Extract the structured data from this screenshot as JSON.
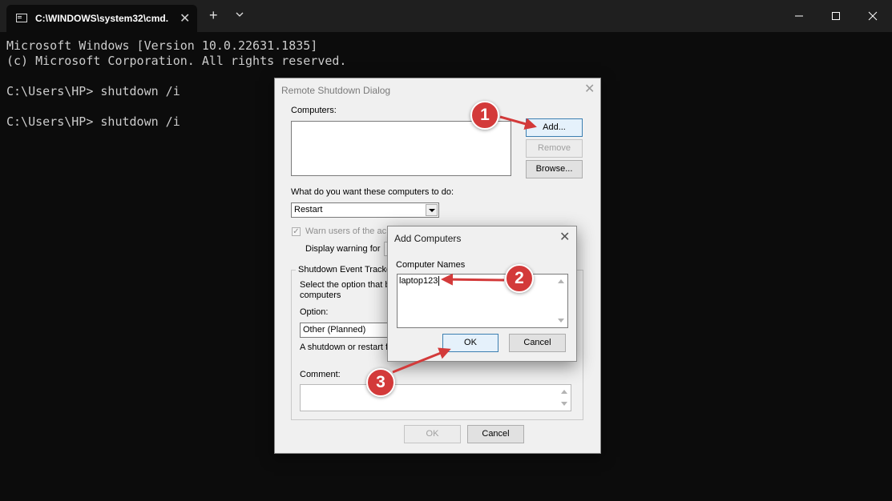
{
  "window": {
    "tab_title": "C:\\WINDOWS\\system32\\cmd.",
    "new_tab_symbol": "+",
    "tab_close_symbol": "✕"
  },
  "terminal": {
    "lines": [
      "Microsoft Windows [Version 10.0.22631.1835]",
      "(c) Microsoft Corporation. All rights reserved.",
      "",
      "C:\\Users\\HP> shutdown /i",
      "",
      "C:\\Users\\HP> shutdown /i"
    ]
  },
  "shutdown_dialog": {
    "title": "Remote Shutdown Dialog",
    "computers_label": "Computers:",
    "add_button": "Add...",
    "remove_button": "Remove",
    "browse_button": "Browse...",
    "action_question": "What do you want these computers to do:",
    "action_selected": "Restart",
    "warn_label": "Warn users of the ac",
    "display_warning_label": "Display warning for",
    "tracker_group_label": "Shutdown Event Tracke",
    "tracker_text_1": "Select the option that b",
    "tracker_text_2": "computers",
    "option_label": "Option:",
    "option_selected": "Other (Planned)",
    "option_description": "A shutdown or restart fo",
    "comment_label": "Comment:",
    "ok_button": "OK",
    "cancel_button": "Cancel"
  },
  "add_dialog": {
    "title": "Add Computers",
    "names_label": "Computer Names",
    "names_value": "laptop123",
    "ok_button": "OK",
    "cancel_button": "Cancel"
  },
  "annotations": {
    "step1": "1",
    "step2": "2",
    "step3": "3",
    "color": "#d33a3a"
  }
}
